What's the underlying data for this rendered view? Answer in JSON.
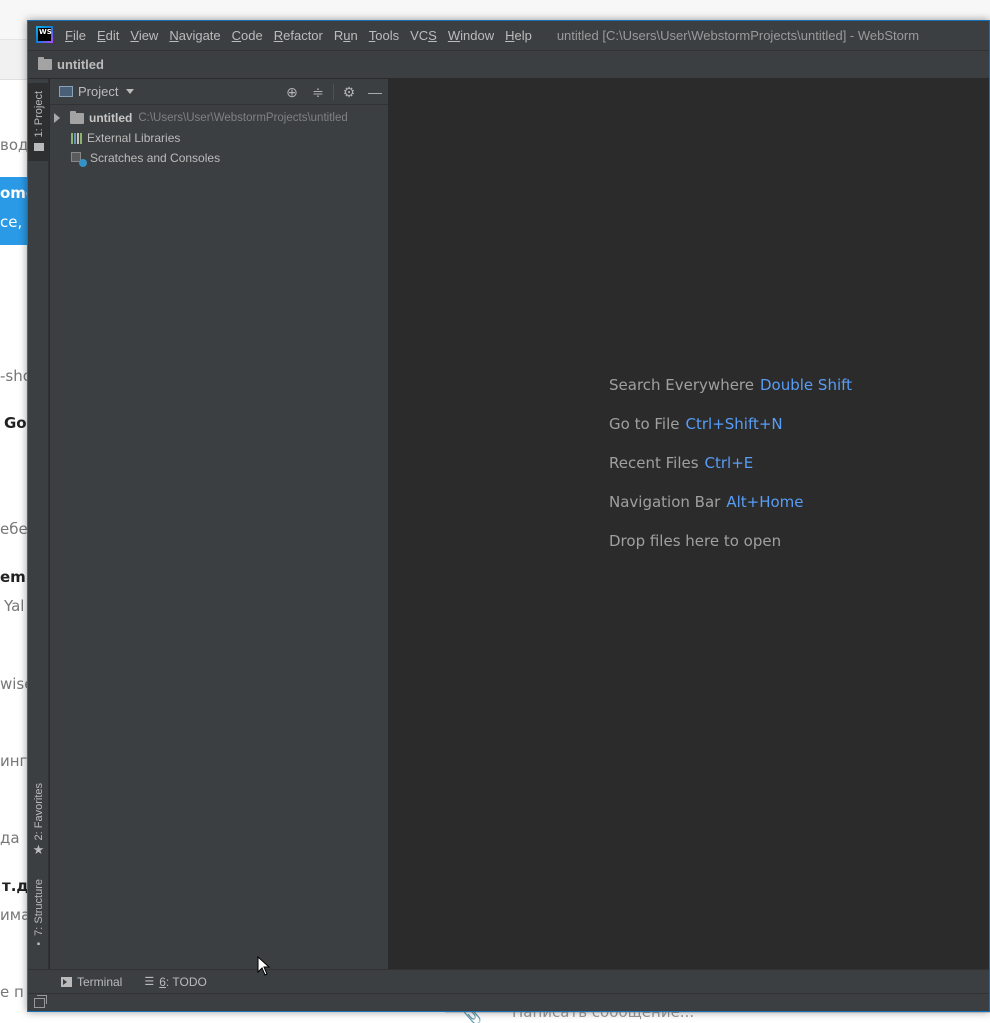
{
  "background": {
    "fragments": [
      {
        "text": "вод",
        "bold": false
      },
      {
        "text": "-sho",
        "bold": false
      },
      {
        "text": "Go",
        "bold": true
      },
      {
        "text": "ебе",
        "bold": false
      },
      {
        "text": "em",
        "bold": true
      },
      {
        "text": "Yal",
        "bold": false
      },
      {
        "text": "wise",
        "bold": false
      },
      {
        "text": "инг",
        "bold": false
      },
      {
        "text": "да",
        "bold": false
      },
      {
        "text": "т.д.",
        "bold": true
      },
      {
        "text": "има",
        "bold": false
      },
      {
        "text": "е п",
        "bold": false
      }
    ],
    "blue_box": {
      "line1": "ome",
      "line2": "се, я"
    },
    "message_placeholder": "Написать сообщение..."
  },
  "titlebar": {
    "logo": "WS",
    "menu": [
      {
        "label": "File",
        "u": "F",
        "rest": "ile"
      },
      {
        "label": "Edit",
        "u": "E",
        "rest": "dit"
      },
      {
        "label": "View",
        "u": "V",
        "rest": "iew"
      },
      {
        "label": "Navigate",
        "u": "N",
        "rest": "avigate"
      },
      {
        "label": "Code",
        "u": "C",
        "rest": "ode"
      },
      {
        "label": "Refactor",
        "u": "R",
        "rest": "efactor"
      },
      {
        "label": "Run",
        "pre": "R",
        "u": "u",
        "rest": "n"
      },
      {
        "label": "Tools",
        "u": "T",
        "rest": "ools"
      },
      {
        "label": "VCS",
        "pre": "VC",
        "u": "S",
        "rest": ""
      },
      {
        "label": "Window",
        "u": "W",
        "rest": "indow"
      },
      {
        "label": "Help",
        "u": "H",
        "rest": "elp"
      }
    ],
    "window_title": "untitled [C:\\Users\\User\\WebstormProjects\\untitled] - WebStorm"
  },
  "navbar": {
    "breadcrumb": "untitled"
  },
  "left_stripe": {
    "project_tab": "1: Project",
    "favorites_tab": "2: Favorites",
    "structure_tab": "7: Structure"
  },
  "project_panel": {
    "view_selector": "Project",
    "tree": {
      "root_name": "untitled",
      "root_path": "C:\\Users\\User\\WebstormProjects\\untitled",
      "external_libraries": "External Libraries",
      "scratches": "Scratches and Consoles"
    }
  },
  "editor": {
    "hints": [
      {
        "label": "Search Everywhere",
        "shortcut": "Double Shift"
      },
      {
        "label": "Go to File",
        "shortcut": "Ctrl+Shift+N"
      },
      {
        "label": "Recent Files",
        "shortcut": "Ctrl+E"
      },
      {
        "label": "Navigation Bar",
        "shortcut": "Alt+Home"
      },
      {
        "label": "Drop files here to open",
        "shortcut": ""
      }
    ]
  },
  "bottom_bar": {
    "terminal": "Terminal",
    "todo_mnemonic": "6",
    "todo_label": ": TODO"
  },
  "colors": {
    "ide_background": "#2b2b2b",
    "panel_background": "#3c3f41",
    "shortcut_blue": "#589df6",
    "hint_gray": "#a0a0a0",
    "window_border": "#1b6fb5"
  }
}
